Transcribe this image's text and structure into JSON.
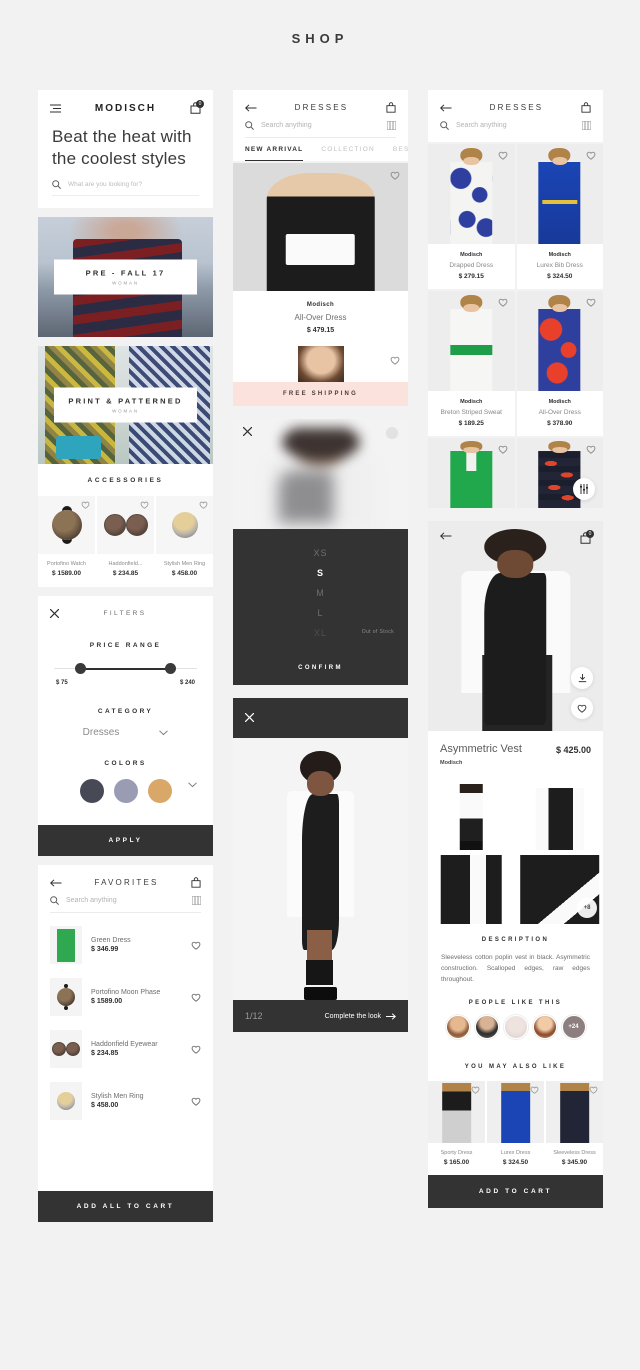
{
  "page": {
    "title": "SHOP"
  },
  "home": {
    "brand": "MODISCH",
    "menu_icon": "hamburger-icon",
    "bag_icon": "bag-icon",
    "bag_count": "0",
    "heading": "Beat the heat with the coolest styles",
    "search_placeholder": "What are you looking for?",
    "banners": [
      {
        "title": "PRE - FALL 17",
        "subtitle": "WOMAN"
      },
      {
        "title": "PRINT & PATTERNED",
        "subtitle": "WOMAN"
      }
    ],
    "accessories_title": "ACCESSORIES",
    "accessories": [
      {
        "name": "Portofino Watch",
        "price": "$ 1589.00"
      },
      {
        "name": "Haddonfield...",
        "price": "$ 234.85"
      },
      {
        "name": "Stylish Men Ring",
        "price": "$ 458.00"
      }
    ]
  },
  "filters": {
    "title": "FILTERS",
    "close_icon": "close-icon",
    "price_range_title": "PRICE RANGE",
    "price_min": "$ 75",
    "price_max": "$ 240",
    "category_title": "CATEGORY",
    "category_value": "Dresses",
    "colors_title": "COLORS",
    "swatches": [
      "#474a56",
      "#9a9cb3",
      "#d9a868"
    ],
    "apply_label": "APPLY"
  },
  "favorites": {
    "title": "FAVORITES",
    "back_icon": "back-arrow-icon",
    "bag_icon": "bag-icon",
    "search_placeholder": "Search anything",
    "items": [
      {
        "name": "Green Dress",
        "price": "$ 346.99"
      },
      {
        "name": "Portofino Moon Phase",
        "price": "$ 1589.00"
      },
      {
        "name": "Haddonfield Eyewear",
        "price": "$ 234.85"
      },
      {
        "name": "Stylish Men Ring",
        "price": "$ 458.00"
      }
    ],
    "add_all_label": "ADD ALL TO CART"
  },
  "listing": {
    "title": "DRESSES",
    "back_icon": "back-arrow-icon",
    "bag_icon": "bag-icon",
    "search_placeholder": "Search anything",
    "grid_icon": "grid-view-icon",
    "tabs": [
      {
        "label": "NEW ARRIVAL",
        "active": true
      },
      {
        "label": "COLLECTION",
        "active": false
      },
      {
        "label": "BEST SELLE",
        "active": false
      }
    ],
    "featured": {
      "brand": "Modisch",
      "name": "All-Over Dress",
      "price": "$ 479.15"
    },
    "free_shipping": "FREE SHIPPING"
  },
  "size_picker": {
    "close_icon": "close-icon",
    "sizes": [
      {
        "label": "XS",
        "state": "normal"
      },
      {
        "label": "S",
        "state": "selected"
      },
      {
        "label": "M",
        "state": "normal"
      },
      {
        "label": "L",
        "state": "normal"
      },
      {
        "label": "XL",
        "state": "out-of-stock"
      }
    ],
    "out_of_stock_label": "Out of Stock",
    "confirm_label": "CONFIRM"
  },
  "look_viewer": {
    "close_icon": "close-icon",
    "counter": "1/12",
    "cta": "Complete the look"
  },
  "catalog": {
    "title": "DRESSES",
    "back_icon": "back-arrow-icon",
    "bag_icon": "bag-icon",
    "search_placeholder": "Search anything",
    "grid_icon": "grid-view-icon",
    "filter_icon": "sliders-filter-icon",
    "products": [
      {
        "brand": "Modisch",
        "name": "Drapped Dress",
        "price": "$ 279.15"
      },
      {
        "brand": "Modisch",
        "name": "Lurex Bib Dress",
        "price": "$ 324.50"
      },
      {
        "brand": "Modisch",
        "name": "Breton Striped Sweat",
        "price": "$ 189.25"
      },
      {
        "brand": "Modisch",
        "name": "All-Over Dress",
        "price": "$ 378.90"
      }
    ]
  },
  "detail": {
    "back_icon": "back-arrow-icon",
    "bag_icon": "bag-icon",
    "bag_count": "0",
    "download_icon": "download-icon",
    "heart_icon": "heart-icon",
    "name": "Asymmetric Vest",
    "price": "$ 425.00",
    "brand": "Modisch",
    "more_thumbs": "+8",
    "description_title": "DESCRIPTION",
    "description_body": "Sleeveless cotton poplin vest in black. Asymmetric construction. Scalloped edges, raw edges throughout.",
    "people_title": "PEOPLE LIKE THIS",
    "people_more": "+24",
    "also_like_title": "YOU MAY ALSO LIKE",
    "also_like": [
      {
        "name": "Sporty Dress",
        "price": "$ 165.00"
      },
      {
        "name": "Lurex Dress",
        "price": "$ 324.50"
      },
      {
        "name": "Sleeveless Dress",
        "price": "$ 345.90"
      }
    ],
    "add_to_cart_label": "ADD TO CART"
  }
}
